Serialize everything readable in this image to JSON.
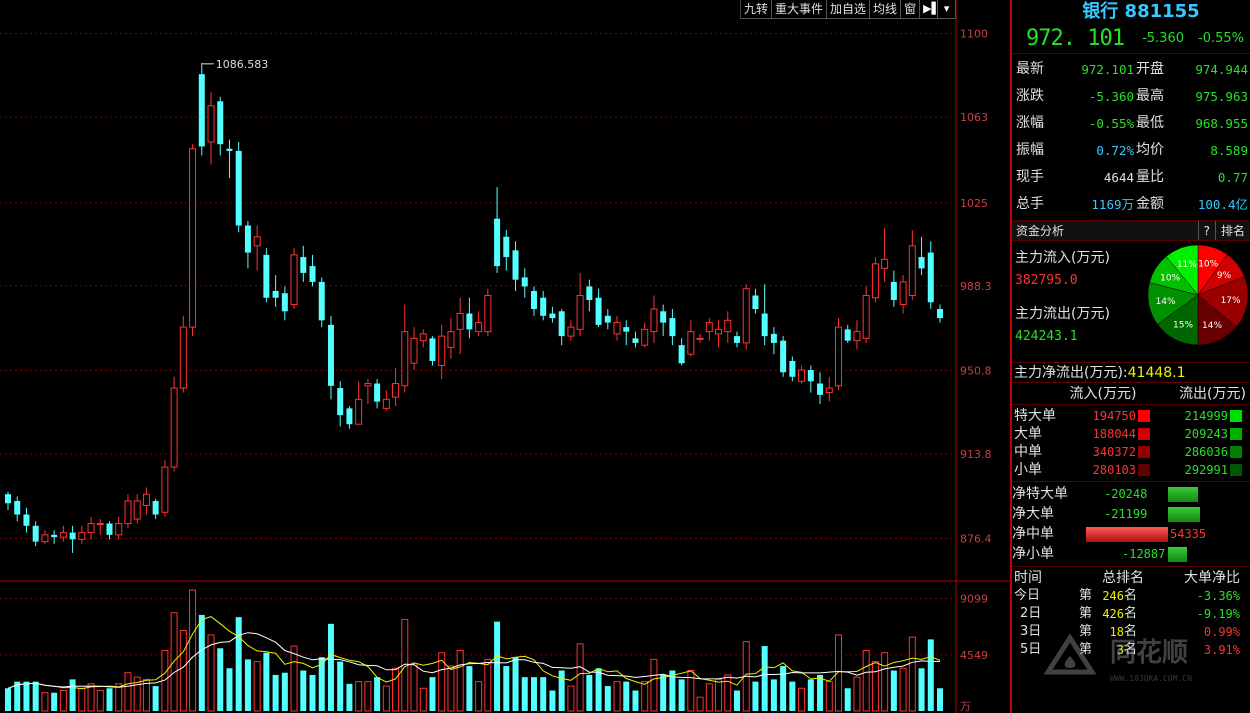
{
  "toolbar": {
    "items": [
      "九转",
      "重大事件",
      "加自选",
      "均线",
      "窗",
      "▶▌",
      "▾"
    ]
  },
  "colors": {
    "up": "#ff3232",
    "down": "#54ffff",
    "grid": "#7a0000",
    "axis_text": "#c84040",
    "green": "#28e028",
    "yellow": "#f0f000",
    "cyan": "#38c8ff"
  },
  "chart_data": [
    {
      "type": "candlestick",
      "y_ticks": [
        "1100",
        "1063",
        "1025",
        "988.3",
        "950.8",
        "913.8",
        "876.4"
      ],
      "ylim": [
        858,
        1106
      ],
      "annotation": "1086.583",
      "candles": [
        [
          896,
          892,
          897,
          889
        ],
        [
          893,
          887,
          895,
          884
        ],
        [
          887,
          882,
          890,
          879
        ],
        [
          882,
          875,
          884,
          873
        ],
        [
          875,
          878,
          880,
          874
        ],
        [
          878,
          877,
          880,
          874
        ],
        [
          877,
          879,
          882,
          875
        ],
        [
          879,
          876,
          882,
          870
        ],
        [
          876,
          879,
          882,
          874
        ],
        [
          879,
          883,
          886,
          876
        ],
        [
          883,
          883,
          885,
          878
        ],
        [
          883,
          878,
          884,
          876
        ],
        [
          878,
          883,
          886,
          876
        ],
        [
          883,
          893,
          896,
          881
        ],
        [
          885,
          893,
          896,
          883
        ],
        [
          891,
          896,
          899,
          887
        ],
        [
          893,
          887,
          894,
          885
        ],
        [
          888,
          908,
          911,
          886
        ],
        [
          908,
          943,
          948,
          906
        ],
        [
          943,
          970,
          975,
          941
        ],
        [
          970,
          1049,
          1051,
          966
        ],
        [
          1082,
          1050,
          1087,
          1046
        ],
        [
          1052,
          1068,
          1074,
          1042
        ],
        [
          1070,
          1051,
          1072,
          1046
        ],
        [
          1049,
          1048,
          1053,
          1036
        ],
        [
          1048,
          1015,
          1052,
          1012
        ],
        [
          1015,
          1003,
          1017,
          996
        ],
        [
          1006,
          1010,
          1015,
          995
        ],
        [
          1002,
          983,
          1005,
          981
        ],
        [
          986,
          983,
          993,
          979
        ],
        [
          985,
          977,
          988,
          973
        ],
        [
          980,
          1002,
          1005,
          978
        ],
        [
          1001,
          994,
          1006,
          990
        ],
        [
          997,
          990,
          1002,
          988
        ],
        [
          990,
          973,
          992,
          970
        ],
        [
          971,
          944,
          975,
          938
        ],
        [
          943,
          931,
          946,
          926
        ],
        [
          934,
          927,
          935,
          925
        ],
        [
          927,
          938,
          946,
          935
        ],
        [
          944,
          945,
          947,
          936
        ],
        [
          945,
          937,
          947,
          934
        ],
        [
          934,
          938,
          942,
          933
        ],
        [
          939,
          945,
          952,
          935
        ],
        [
          944,
          968,
          980,
          941
        ],
        [
          954,
          965,
          970,
          951
        ],
        [
          964,
          967,
          969,
          961
        ],
        [
          965,
          955,
          966,
          953
        ],
        [
          953,
          966,
          971,
          947
        ],
        [
          961,
          968,
          974,
          956
        ],
        [
          969,
          976,
          983,
          958
        ],
        [
          976,
          969,
          983,
          965
        ],
        [
          968,
          972,
          977,
          966
        ],
        [
          968,
          984,
          987,
          966
        ],
        [
          1018,
          997,
          1032,
          994
        ],
        [
          1010,
          1001,
          1013,
          995
        ],
        [
          1004,
          991,
          1008,
          986
        ],
        [
          992,
          988,
          996,
          983
        ],
        [
          986,
          978,
          988,
          975
        ],
        [
          983,
          975,
          986,
          973
        ],
        [
          976,
          974,
          979,
          972
        ],
        [
          977,
          966,
          978,
          962
        ],
        [
          966,
          970,
          973,
          964
        ],
        [
          969,
          984,
          994,
          966
        ],
        [
          988,
          982,
          991,
          977
        ],
        [
          983,
          971,
          987,
          970
        ],
        [
          975,
          972,
          978,
          969
        ],
        [
          967,
          972,
          975,
          964
        ],
        [
          970,
          968,
          973,
          962
        ],
        [
          965,
          963,
          968,
          961
        ],
        [
          962,
          969,
          972,
          961
        ],
        [
          968,
          978,
          984,
          963
        ],
        [
          977,
          972,
          980,
          966
        ],
        [
          974,
          966,
          978,
          962
        ],
        [
          962,
          954,
          965,
          953
        ],
        [
          958,
          968,
          973,
          957
        ],
        [
          965,
          965,
          967,
          963
        ],
        [
          968,
          972,
          974,
          964
        ],
        [
          967,
          969,
          973,
          961
        ],
        [
          968,
          973,
          977,
          963
        ],
        [
          966,
          963,
          968,
          961
        ],
        [
          963,
          987,
          989,
          960
        ],
        [
          984,
          978,
          987,
          976
        ],
        [
          976,
          966,
          989,
          962
        ],
        [
          967,
          963,
          970,
          958
        ],
        [
          964,
          950,
          966,
          948
        ],
        [
          955,
          948,
          957,
          946
        ],
        [
          946,
          951,
          953,
          945
        ],
        [
          951,
          946,
          953,
          941
        ],
        [
          945,
          940,
          950,
          936
        ],
        [
          941,
          943,
          948,
          937
        ],
        [
          944,
          970,
          974,
          942
        ],
        [
          969,
          964,
          971,
          963
        ],
        [
          964,
          968,
          973,
          960
        ],
        [
          965,
          984,
          988,
          963
        ],
        [
          983,
          998,
          1001,
          981
        ],
        [
          996,
          1000,
          1014,
          990
        ],
        [
          990,
          982,
          995,
          979
        ],
        [
          980,
          990,
          993,
          976
        ],
        [
          984,
          1006,
          1013,
          982
        ],
        [
          1001,
          996,
          1010,
          993
        ],
        [
          1003,
          981,
          1008,
          978
        ],
        [
          978,
          974,
          980,
          972
        ]
      ]
    },
    {
      "type": "bar",
      "y_ticks": [
        "9099",
        "4549"
      ],
      "unit": "万",
      "ylim": [
        0,
        9800
      ]
    }
  ],
  "stock": {
    "title": "银行 881155",
    "price": "972. 101",
    "change": "-5.360",
    "pct": "-0.55%"
  },
  "quote": [
    {
      "l1": "最新",
      "v1": "972.101",
      "c1": "#28e028",
      "l2": "开盘",
      "v2": "974.944",
      "c2": "#28e028"
    },
    {
      "l1": "涨跌",
      "v1": "-5.360",
      "c1": "#28e028",
      "l2": "最高",
      "v2": "975.963",
      "c2": "#28e028"
    },
    {
      "l1": "涨幅",
      "v1": "-0.55%",
      "c1": "#28e028",
      "l2": "最低",
      "v2": "968.955",
      "c2": "#28e028"
    },
    {
      "l1": "振幅",
      "v1": "0.72%",
      "c1": "#38c8ff",
      "l2": "均价",
      "v2": "8.589",
      "c2": "#28e028"
    },
    {
      "l1": "现手",
      "v1": "4644",
      "c1": "#e0e0e0",
      "l2": "量比",
      "v2": "0.77",
      "c2": "#28e028"
    },
    {
      "l1": "总手",
      "v1": "1169万",
      "c1": "#38c8ff",
      "l2": "金额",
      "v2": "100.4亿",
      "c2": "#38c8ff"
    }
  ],
  "fund": {
    "title": "资金分析",
    "help": "?",
    "rank": "排名",
    "inflow_label": "主力流入(万元)",
    "inflow": "382795.0",
    "outflow_label": "主力流出(万元)",
    "outflow": "424243.1",
    "net_label": "主力净流出(万元):",
    "net": "41448.1",
    "pie": [
      {
        "pct": "10%",
        "value": 10,
        "color": "#ff0000"
      },
      {
        "pct": "9%",
        "value": 9,
        "color": "#d00000"
      },
      {
        "pct": "17%",
        "value": 17,
        "color": "#9a0000"
      },
      {
        "pct": "14%",
        "value": 14,
        "color": "#660000"
      },
      {
        "pct": "15%",
        "value": 15,
        "color": "#006600"
      },
      {
        "pct": "14%",
        "value": 14,
        "color": "#009000"
      },
      {
        "pct": "10%",
        "value": 10,
        "color": "#00c000"
      },
      {
        "pct": "11%",
        "value": 11,
        "color": "#00f000"
      }
    ]
  },
  "flows": {
    "head_in": "流入(万元)",
    "head_out": "流出(万元)",
    "rows": [
      {
        "label": "特大单",
        "in": "194750",
        "out": "214999",
        "cin": "#ff0000",
        "cout": "#00e000"
      },
      {
        "label": "大单",
        "in": "188044",
        "out": "209243",
        "cin": "#d00000",
        "cout": "#00b000"
      },
      {
        "label": "中单",
        "in": "340372",
        "out": "286036",
        "cin": "#900000",
        "cout": "#008000"
      },
      {
        "label": "小单",
        "in": "280103",
        "out": "292991",
        "cin": "#600000",
        "cout": "#005800"
      }
    ]
  },
  "net": [
    {
      "label": "净特大单",
      "value": "-20248",
      "amount": -20248
    },
    {
      "label": "净大单",
      "value": "-21199",
      "amount": -21199
    },
    {
      "label": "净中单",
      "value": "54335",
      "amount": 54335
    },
    {
      "label": "净小单",
      "value": "-12887",
      "amount": -12887
    }
  ],
  "ranking": {
    "h_time": "时间",
    "h_rank": "总排名",
    "h_ratio": "大单净比",
    "di": "第",
    "ming": "名",
    "rows": [
      {
        "t": "今日",
        "n": "246",
        "p": "-3.36%",
        "c": "#28e028"
      },
      {
        "t": "2日",
        "n": "426",
        "p": "-9.19%",
        "c": "#28e028"
      },
      {
        "t": "3日",
        "n": "18",
        "p": "0.99%",
        "c": "#ff3232"
      },
      {
        "t": "5日",
        "n": "3",
        "p": "3.91%",
        "c": "#ff3232"
      }
    ]
  },
  "watermark": {
    "text": "同花顺",
    "url": "WWW.10JQKA.COM.CN"
  }
}
